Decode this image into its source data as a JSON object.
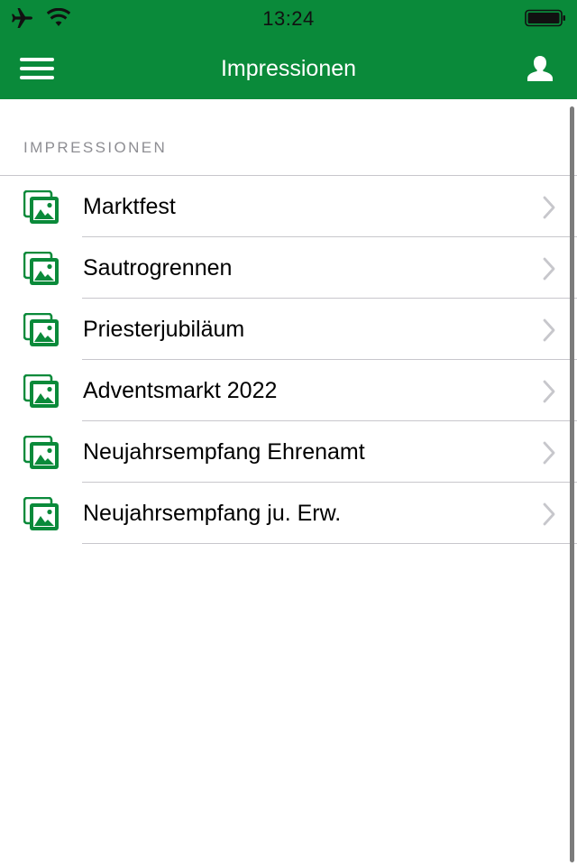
{
  "status_bar": {
    "time": "13:24",
    "icons": [
      "airplane-icon",
      "wifi-icon",
      "battery-icon"
    ]
  },
  "nav": {
    "title": "Impressionen",
    "left_icon": "hamburger-menu-icon",
    "right_icon": "user-icon"
  },
  "section": {
    "header": "IMPRESSIONEN"
  },
  "items": [
    {
      "label": "Marktfest",
      "icon": "photo-gallery-icon"
    },
    {
      "label": "Sautrogrennen",
      "icon": "photo-gallery-icon"
    },
    {
      "label": "Priesterjubiläum",
      "icon": "photo-gallery-icon"
    },
    {
      "label": "Adventsmarkt 2022",
      "icon": "photo-gallery-icon"
    },
    {
      "label": "Neujahrsempfang Ehrenamt",
      "icon": "photo-gallery-icon"
    },
    {
      "label": "Neujahrsempfang ju. Erw.",
      "icon": "photo-gallery-icon"
    }
  ],
  "colors": {
    "brand_green": "#0a8a3a",
    "separator": "#c8c7cc",
    "section_header": "#8e8e93",
    "chevron": "#c7c7cc"
  }
}
